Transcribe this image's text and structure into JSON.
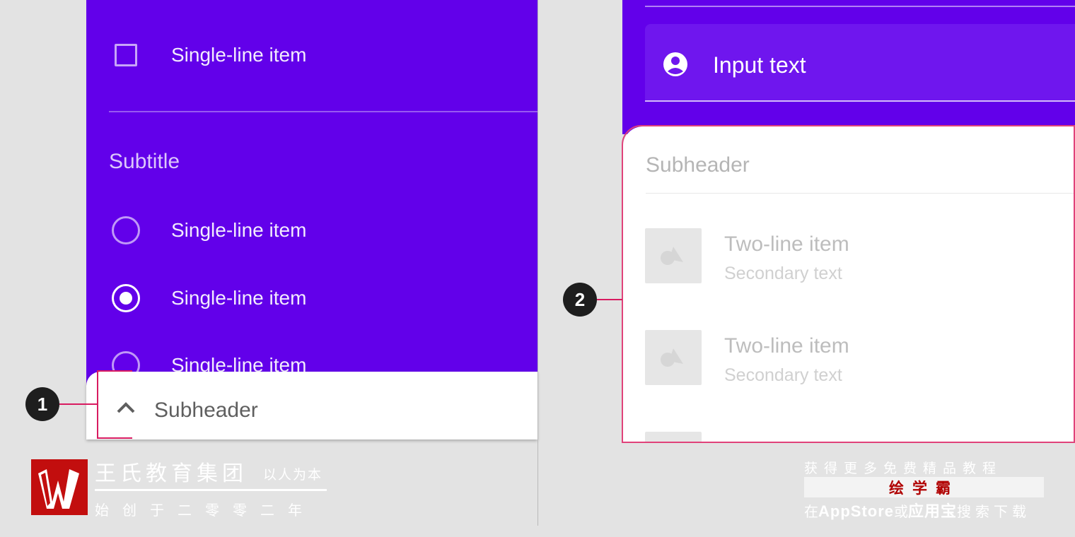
{
  "left": {
    "item_checkbox": "Single-line item",
    "subtitle": "Subtitle",
    "radio_items": [
      "Single-line item",
      "Single-line item",
      "Single-line item"
    ],
    "sheet_title": "Subheader",
    "callout_number": "1"
  },
  "right": {
    "input_text": "Input text",
    "subheader": "Subheader",
    "list": [
      {
        "primary": "Two-line item",
        "secondary": "Secondary text"
      },
      {
        "primary": "Two-line item",
        "secondary": "Secondary text"
      }
    ],
    "callout_number": "2"
  },
  "colors": {
    "primary": "#6200ea",
    "callout_line": "#d81b60",
    "logo": "#c20e0e"
  },
  "watermark": {
    "brand_name": "王氏教育集团",
    "brand_slogan": "以人为本",
    "brand_founded": "始创于二零零二年",
    "promo_line1": "获得更多免费精品教程",
    "promo_app": "绘学霸",
    "promo_line3_pre": "在",
    "promo_store1": "AppStore",
    "promo_line3_mid": "或",
    "promo_store2": "应用宝",
    "promo_line3_post": "搜索下载"
  }
}
